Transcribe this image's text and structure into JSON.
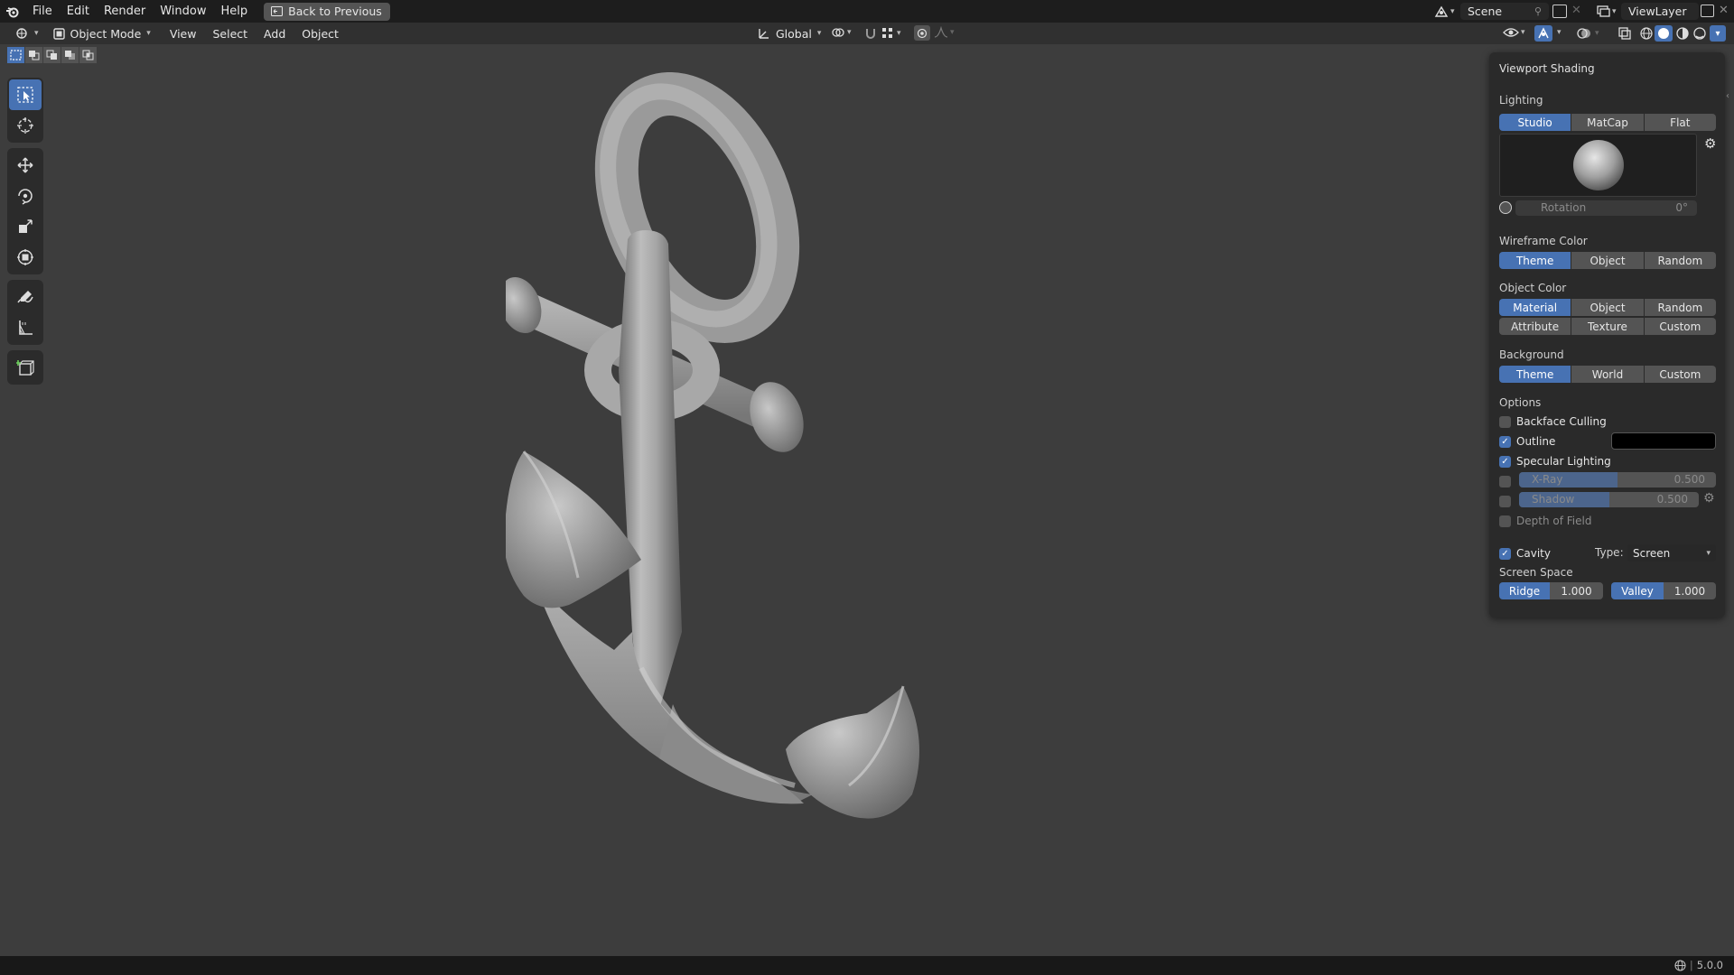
{
  "menu": {
    "items": [
      "File",
      "Edit",
      "Render",
      "Window",
      "Help"
    ],
    "back_label": "Back to Previous",
    "scene": "Scene",
    "view_layer": "ViewLayer"
  },
  "header": {
    "mode": "Object Mode",
    "menus": [
      "View",
      "Select",
      "Add",
      "Object"
    ],
    "orientation": "Global"
  },
  "panel": {
    "title": "Viewport Shading",
    "lighting_label": "Lighting",
    "lighting": [
      "Studio",
      "MatCap",
      "Flat"
    ],
    "lighting_active": "Studio",
    "rotation_label": "Rotation",
    "rotation_value": "0°",
    "wireframe_label": "Wireframe Color",
    "wireframe": [
      "Theme",
      "Object",
      "Random"
    ],
    "object_color_label": "Object Color",
    "object_color_row1": [
      "Material",
      "Object",
      "Random"
    ],
    "object_color_row2": [
      "Attribute",
      "Texture",
      "Custom"
    ],
    "background_label": "Background",
    "background": [
      "Theme",
      "World",
      "Custom"
    ],
    "options_label": "Options",
    "backface": "Backface Culling",
    "outline": "Outline",
    "outline_color": "#000000",
    "specular": "Specular Lighting",
    "xray_label": "X-Ray",
    "xray_value": "0.500",
    "xray_level": 0.5,
    "shadow_label": "Shadow",
    "shadow_value": "0.500",
    "shadow_level": 0.5,
    "dof": "Depth of Field",
    "cavity": "Cavity",
    "type_label": "Type:",
    "type_value": "Screen",
    "screen_space_label": "Screen Space",
    "ridge_label": "Ridge",
    "ridge_value": "1.000",
    "valley_label": "Valley",
    "valley_value": "1.000"
  },
  "status": {
    "version": "5.0.0"
  },
  "colors": {
    "accent": "#4772b3",
    "viewport_bg": "#3d3d3d"
  }
}
